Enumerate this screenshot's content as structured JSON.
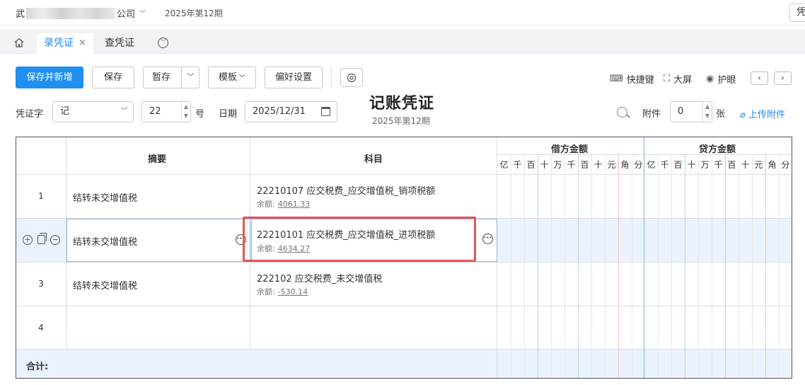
{
  "topbar": {
    "company_prefix": "武",
    "company_suffix": "公司",
    "period": "2025年第12期",
    "corner_label": "凭"
  },
  "tabs": [
    {
      "label": "录凭证",
      "active": true,
      "close": "×"
    },
    {
      "label": "查凭证",
      "active": false
    }
  ],
  "toolbar": {
    "save_new": "保存并新增",
    "save": "保存",
    "temp_save": "暂存",
    "template": "模板",
    "preferences": "偏好设置",
    "shortcuts": "快捷键",
    "fullscreen": "大屏",
    "eye_care": "护眼",
    "prev": "‹",
    "next": "›"
  },
  "voucher": {
    "title": "记账凭证",
    "period": "2025年第12期",
    "word_label": "凭证字",
    "word_value": "记",
    "number_value": "22",
    "number_suffix": "号",
    "date_label": "日期",
    "date_value": "2025/12/31",
    "attachment_label": "附件",
    "attachment_value": "0",
    "attachment_unit": "张",
    "upload_label": "上传附件"
  },
  "grid": {
    "col_summary": "摘要",
    "col_subject": "科目",
    "col_debit": "借方金额",
    "col_credit": "贷方金额",
    "digits": [
      "亿",
      "千",
      "百",
      "十",
      "万",
      "千",
      "百",
      "十",
      "元",
      "角",
      "分"
    ],
    "balance_label": "余额:",
    "total_label": "合计:",
    "rows": [
      {
        "num": "1",
        "summary": "结转未交增值税",
        "subject": "22210107 应交税费_应交增值税_销项税额",
        "balance": "4061.33"
      },
      {
        "num": "",
        "summary": "结转未交增值税",
        "subject": "22210101 应交税费_应交增值税_进项税额",
        "balance": "4634.27"
      },
      {
        "num": "3",
        "summary": "结转未交增值税",
        "subject": "222102 应交税费_未交增值税",
        "balance": "-530.14"
      },
      {
        "num": "4",
        "summary": "",
        "subject": "",
        "balance": ""
      }
    ]
  }
}
